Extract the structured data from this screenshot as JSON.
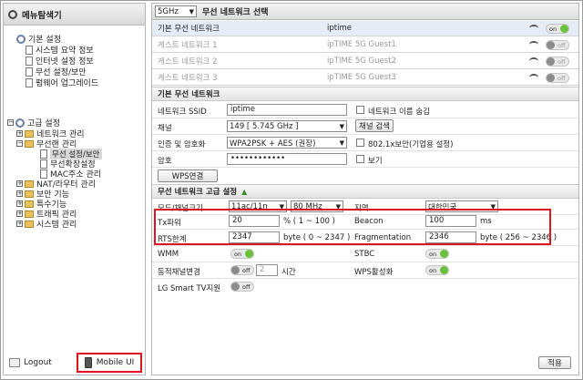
{
  "sidebar": {
    "title": "메뉴탐색기",
    "basic": {
      "label": "기본 설정",
      "items": [
        "시스템 요약 정보",
        "인터넷 설정 정보",
        "무선 설정/보안",
        "펌웨어 업그레이드"
      ]
    },
    "advanced": {
      "label": "고급 설정",
      "items": [
        "네트워크 관리",
        "무선랜 관리",
        "무선 설정/보안",
        "무선확장설정",
        "MAC주소 관리",
        "NAT/라우터 관리",
        "보안 기능",
        "특수기능",
        "트래픽 관리",
        "시스템 관리"
      ]
    },
    "logout": "Logout",
    "mobile_ui": "Mobile UI"
  },
  "main": {
    "band": "5GHz",
    "section_title": "무선 네트워크 선택",
    "networks": [
      {
        "name": "기본 무선 네트워크",
        "ssid": "iptime",
        "state": "on"
      },
      {
        "name": "게스트 네트워크 1",
        "ssid": "ipTIME 5G Guest1",
        "state": "off"
      },
      {
        "name": "게스트 네트워크 2",
        "ssid": "ipTIME 5G Guest2",
        "state": "off"
      },
      {
        "name": "게스트 네트워크 3",
        "ssid": "ipTIME 5G Guest3",
        "state": "off"
      }
    ],
    "basic": {
      "title": "기본 무선 네트워크",
      "ssid_label": "네트워크 SSID",
      "ssid_value": "iptime",
      "hide_label": "네트워크 이름 숨김",
      "channel_label": "채널",
      "channel_value": "149 [ 5.745 GHz ]",
      "channel_search": "채널 검색",
      "auth_label": "인증 및 암호화",
      "auth_value": "WPA2PSK + AES (권장)",
      "dot1x_label": "802.1x보안(기업용 설정)",
      "pw_label": "암호",
      "pw_value": "••••••••••••",
      "show_label": "보기",
      "wps_button": "WPS연결"
    },
    "advanced": {
      "title": "무선 네트워크 고급 설정",
      "mode_label": "모드/채널크기",
      "mode_value": "11ac/11n",
      "width_value": "80 MHz",
      "region_label": "지역",
      "region_value": "대한민국",
      "tx_label": "Tx파워",
      "tx_value": "20",
      "tx_unit": "% ( 1 ~ 100 )",
      "beacon_label": "Beacon",
      "beacon_value": "100",
      "beacon_unit": "ms",
      "rts_label": "RTS한계",
      "rts_value": "2347",
      "rts_unit": "byte ( 0 ~ 2347 )",
      "frag_label": "Fragmentation",
      "frag_value": "2346",
      "frag_unit": "byte ( 256 ~ 2346 )",
      "wmm_label": "WMM",
      "wmm_state": "on",
      "stbc_label": "STBC",
      "stbc_state": "on",
      "dyn_label": "동적채널변경",
      "dyn_state": "off",
      "dyn_value": "2",
      "dyn_unit": "시간",
      "wps_label": "WPS활성화",
      "wps_state": "on",
      "lg_label": "LG Smart TV지원",
      "lg_state": "off"
    },
    "apply_button": "적용"
  },
  "icons": [
    "search-icon",
    "folder-icon",
    "page-icon",
    "gear-icon",
    "wifi-icon",
    "logout-icon",
    "mobile-icon"
  ],
  "colors": {
    "highlight_red": "#e0141e",
    "toggle_on": "#6bc13d",
    "toggle_off": "#8c8c8c"
  }
}
